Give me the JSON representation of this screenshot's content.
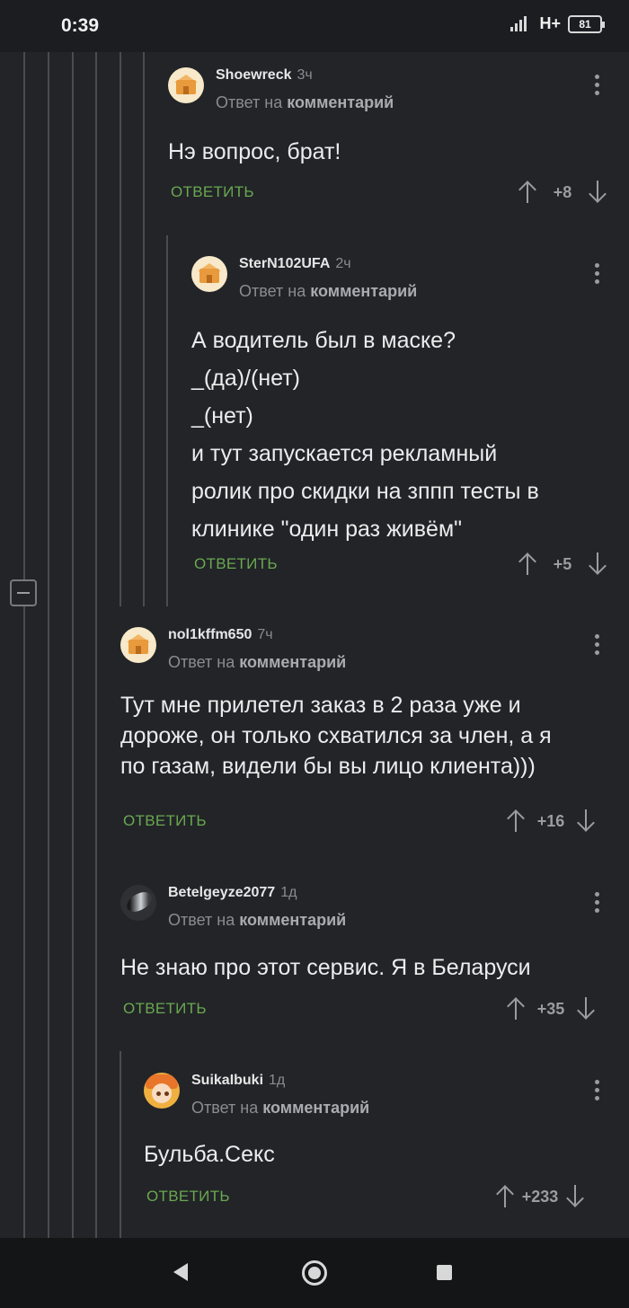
{
  "status_bar": {
    "time": "0:39",
    "network": "H+",
    "battery": "81"
  },
  "comments": [
    {
      "username": "Shoewreck",
      "time": "3ч",
      "reply_prefix": "Ответ на",
      "reply_target": "комментарий",
      "text_lines": [
        "Нэ вопрос, брат!"
      ],
      "reply_label": "ОТВЕТИТЬ",
      "score": "+8"
    },
    {
      "username": "SterN102UFA",
      "time": "2ч",
      "reply_prefix": "Ответ на",
      "reply_target": "комментарий",
      "text_lines": [
        "А водитель был в маске?",
        "_(да)/(нет)",
        "_(нет)",
        "и тут запускается рекламный",
        "ролик про скидки на зппп тесты в",
        "клинике \"один раз живём\""
      ],
      "reply_label": "ОТВЕТИТЬ",
      "score": "+5"
    },
    {
      "username": "nol1kffm650",
      "time": "7ч",
      "reply_prefix": "Ответ на",
      "reply_target": "комментарий",
      "text_lines": [
        "Тут мне прилетел заказ в 2 раза уже и",
        "дороже, он только схватился за член, а я",
        "по газам, видели бы вы лицо клиента)))"
      ],
      "reply_label": "ОТВЕТИТЬ",
      "score": "+16"
    },
    {
      "username": "Betelgeyze2077",
      "time": "1д",
      "reply_prefix": "Ответ на",
      "reply_target": "комментарий",
      "text_lines": [
        "Не знаю про этот сервис. Я в Беларуси"
      ],
      "reply_label": "ОТВЕТИТЬ",
      "score": "+35"
    },
    {
      "username": "SuikaIbuki",
      "time": "1д",
      "reply_prefix": "Ответ на",
      "reply_target": "комментарий",
      "text_lines": [
        "Бульба.Секс"
      ],
      "reply_label": "ОТВЕТИТЬ",
      "score": "+233"
    }
  ],
  "icons": {
    "collapse": "minus-square-icon",
    "vote_up": "arrow-up-icon",
    "vote_down": "arrow-down-icon",
    "more": "more-vertical-icon"
  },
  "colors": {
    "background": "#222428",
    "reply_button": "#6aa84f",
    "thread_line": "#4a4c51"
  }
}
